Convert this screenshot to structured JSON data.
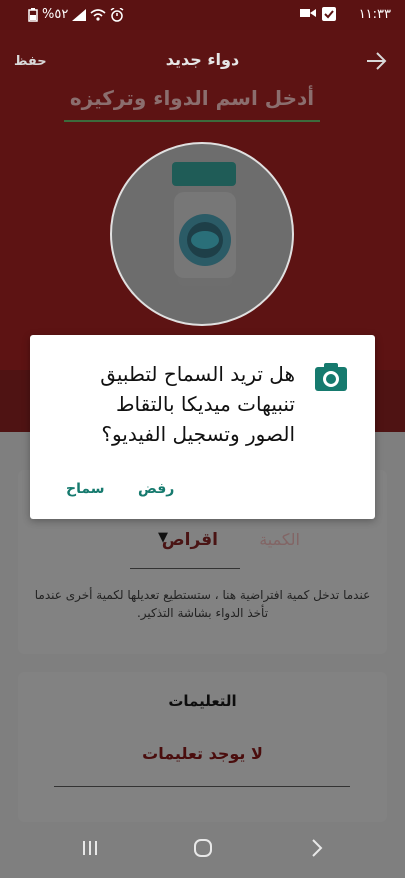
{
  "status_bar": {
    "battery": "%٥٢",
    "time": "١١:٣٣"
  },
  "header": {
    "save_label": "حفظ",
    "title": "دواء جديد",
    "name_placeholder": "أدخل اسم الدواء وتركيزه"
  },
  "form": {
    "quantity_label": "الكمية",
    "unit_value": "اقراص",
    "helper_text": "عندما تدخل كمية افتراضية هنا ، ستستطيع تعديلها لكمية أخرى عندما تأخذ الدواء بشاشة التذكير."
  },
  "instructions": {
    "title": "التعليمات",
    "value": "لا يوجد تعليمات"
  },
  "dialog": {
    "message": "هل تريد السماح لتطبيق تنبيهات ميديكا بالتقاط الصور وتسجيل الفيديو؟",
    "deny_label": "رفض",
    "allow_label": "سماح",
    "accent": "#167a6e"
  },
  "icons": [
    "camera-icon",
    "back-arrow-icon",
    "pill-bottle-icon",
    "wifi-icon",
    "battery-icon",
    "alarm-icon"
  ]
}
